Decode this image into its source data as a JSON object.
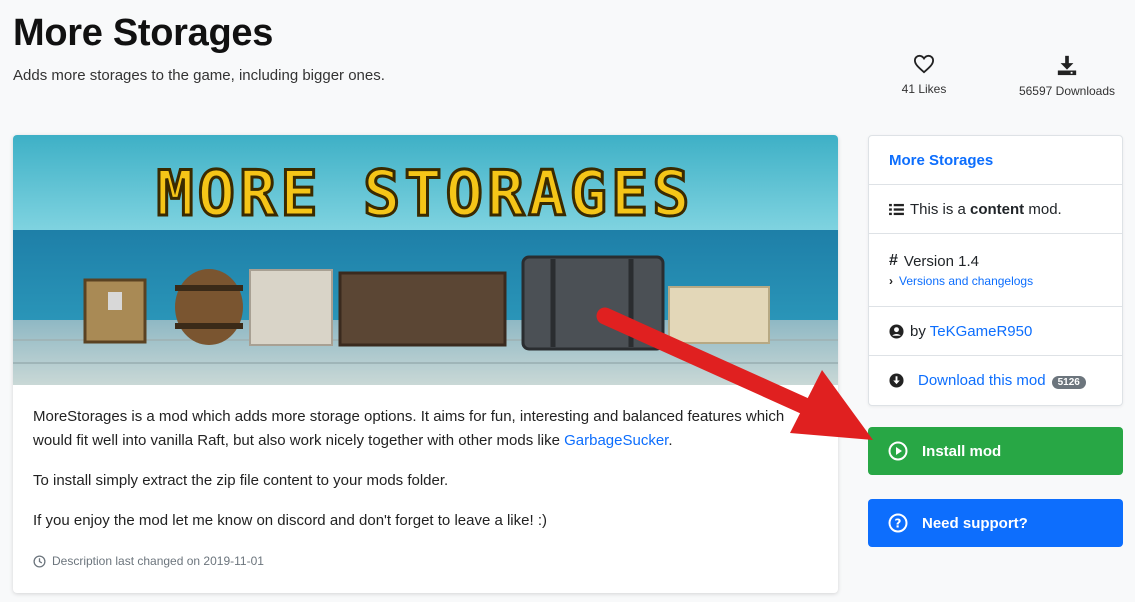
{
  "header": {
    "title": "More Storages",
    "subtitle": "Adds more storages to the game, including bigger ones."
  },
  "stats": {
    "likes": "41 Likes",
    "downloads": "56597 Downloads"
  },
  "banner": {
    "text": "MORE STORAGES"
  },
  "description": {
    "p1_text": "MoreStorages is a mod which adds more storage options. It aims for fun, interesting and balanced features which would fit well into vanilla Raft, but also work nicely together with other mods like ",
    "p1_link": "GarbageSucker",
    "p1_end": ".",
    "p2": "To install simply extract the zip file content to your mods folder.",
    "p3": "If you enjoy the mod let me know on discord and don't forget to leave a like! :)",
    "changed": "Description last changed on 2019-11-01"
  },
  "sidebar": {
    "title": "More Storages",
    "type_prefix": "This is a ",
    "type_bold": "content",
    "type_suffix": " mod.",
    "version": "Version 1.4",
    "versions_link": "Versions and changelogs",
    "author_prefix": "by ",
    "author": "TeKGameR950",
    "download_label": "Download this mod",
    "download_size": "5126"
  },
  "buttons": {
    "install": "Install mod",
    "support": "Need support?"
  },
  "colors": {
    "link": "#0d6efd",
    "install": "#28a745",
    "support": "#0d6efd",
    "arrow": "#e02020"
  }
}
